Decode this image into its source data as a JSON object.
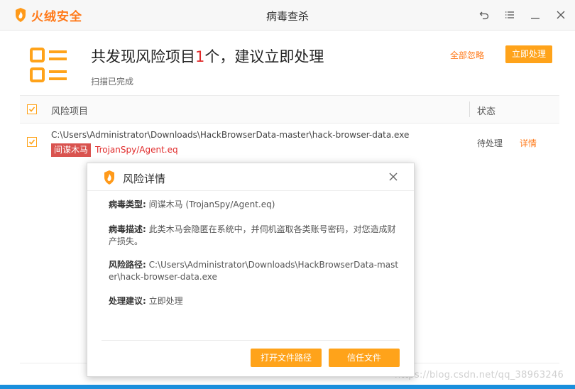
{
  "app": {
    "brand": "火绒安全",
    "window_title": "病毒查杀",
    "accent": "#ffa31a",
    "brand_color": "#ff7a1a"
  },
  "header": {
    "headline_prefix": "共发现风险项目",
    "risk_count": "1",
    "headline_suffix": "个，建议立即处理",
    "status": "扫描已完成",
    "ignore_all": "全部忽略",
    "fix_now": "立即处理"
  },
  "table": {
    "col_risk": "风险项目",
    "col_status": "状态",
    "rows": [
      {
        "path": "C:\\Users\\Administrator\\Downloads\\HackBrowserData-master\\hack-browser-data.exe",
        "tag": "间谍木马",
        "virus": "TrojanSpy/Agent.eq",
        "status": "待处理",
        "detail": "详情"
      }
    ]
  },
  "dialog": {
    "title": "风险详情",
    "type_label": "病毒类型:",
    "type_value": "间谍木马 (TrojanSpy/Agent.eq)",
    "desc_label": "病毒描述:",
    "desc_value": "此类木马会隐匿在系统中，并伺机盗取各类账号密码，对您造成财产损失。",
    "path_label": "风险路径:",
    "path_value": "C:\\Users\\Administrator\\Downloads\\HackBrowserData-master\\hack-browser-data.exe",
    "advice_label": "处理建议:",
    "advice_value": "立即处理",
    "open_path": "打开文件路径",
    "trust_file": "信任文件"
  },
  "watermark": "https://blog.csdn.net/qq_38963246"
}
